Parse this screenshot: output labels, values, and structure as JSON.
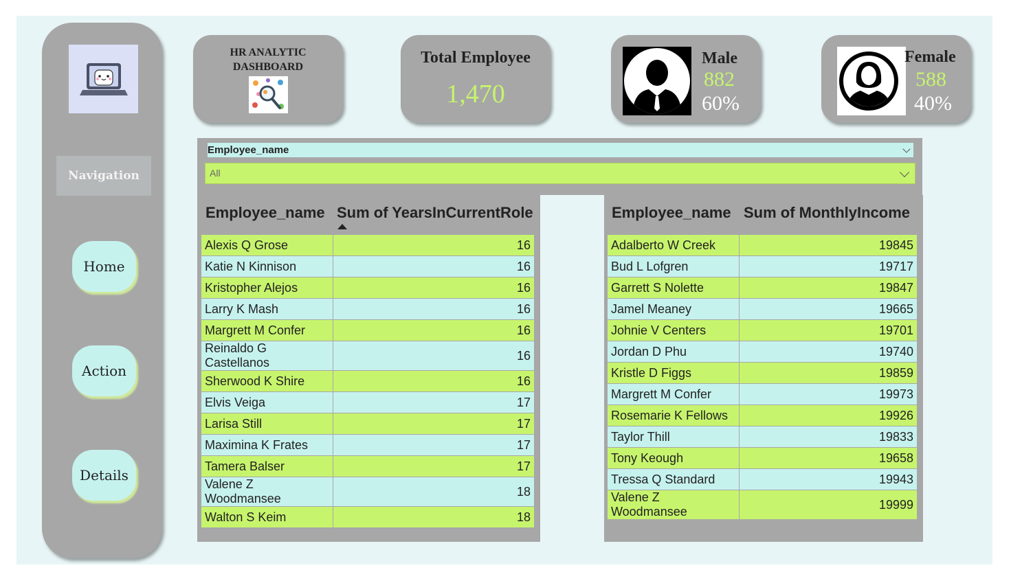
{
  "navigation": {
    "label": "Navigation",
    "buttons": [
      {
        "label": "Home"
      },
      {
        "label": "Action"
      },
      {
        "label": "Details"
      }
    ]
  },
  "title_card": {
    "line1": "HR ANALYTIC",
    "line2": "DASHBOARD"
  },
  "total_card": {
    "title": "Total Employee",
    "value": "1,470"
  },
  "male_card": {
    "title": "Male",
    "count": "882",
    "percent": "60%"
  },
  "female_card": {
    "title": "Female",
    "count": "588",
    "percent": "40%"
  },
  "slicer": {
    "field": "Employee_name",
    "selected": "All"
  },
  "colors": {
    "accent_lime": "#c7f46d",
    "accent_cyan": "#c6f2ee",
    "panel_gray": "#a7a7a7"
  },
  "icons": [
    "laptop-mascot-icon",
    "magnifier-collage-icon",
    "male-person-icon",
    "female-person-icon",
    "chevron-down-icon",
    "sort-ascending-icon"
  ],
  "table_years": {
    "columns": [
      "Employee_name",
      "Sum of YearsInCurrentRole"
    ],
    "rows": [
      {
        "name": "Alexis Q Grose",
        "value": "16"
      },
      {
        "name": "Katie N Kinnison",
        "value": "16"
      },
      {
        "name": "Kristopher Alejos",
        "value": "16"
      },
      {
        "name": "Larry K Mash",
        "value": "16"
      },
      {
        "name": "Margrett M Confer",
        "value": "16"
      },
      {
        "name": "Reinaldo G Castellanos",
        "value": "16"
      },
      {
        "name": "Sherwood K Shire",
        "value": "16"
      },
      {
        "name": "Elvis Veiga",
        "value": "17"
      },
      {
        "name": "Larisa Still",
        "value": "17"
      },
      {
        "name": "Maximina K Frates",
        "value": "17"
      },
      {
        "name": "Tamera Balser",
        "value": "17"
      },
      {
        "name": "Valene Z Woodmansee",
        "value": "18"
      },
      {
        "name": "Walton S Keim",
        "value": "18"
      }
    ]
  },
  "table_income": {
    "columns": [
      "Employee_name",
      "Sum of MonthlyIncome"
    ],
    "rows": [
      {
        "name": "Adalberto W Creek",
        "value": "19845"
      },
      {
        "name": "Bud L Lofgren",
        "value": "19717"
      },
      {
        "name": "Garrett S Nolette",
        "value": "19847"
      },
      {
        "name": "Jamel Meaney",
        "value": "19665"
      },
      {
        "name": "Johnie V Centers",
        "value": "19701"
      },
      {
        "name": "Jordan D Phu",
        "value": "19740"
      },
      {
        "name": "Kristle D Figgs",
        "value": "19859"
      },
      {
        "name": "Margrett M Confer",
        "value": "19973"
      },
      {
        "name": "Rosemarie K Fellows",
        "value": "19926"
      },
      {
        "name": "Taylor Thill",
        "value": "19833"
      },
      {
        "name": "Tony Keough",
        "value": "19658"
      },
      {
        "name": "Tressa Q Standard",
        "value": "19943"
      },
      {
        "name": "Valene Z Woodmansee",
        "value": "19999"
      }
    ]
  }
}
